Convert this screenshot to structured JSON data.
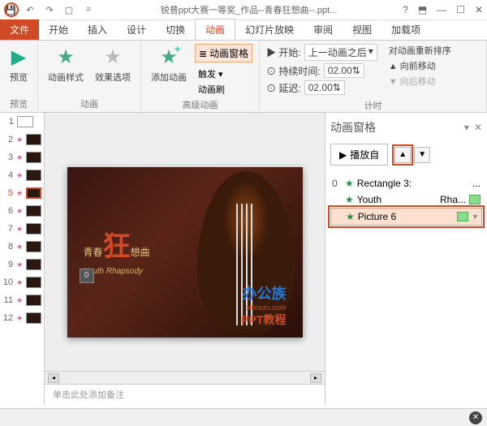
{
  "titlebar": {
    "title": "锐普ppt大赛一等奖_作品--青春狂想曲--.ppt...",
    "qat_undo": "↶",
    "qat_redo": "↷",
    "qat_slideshow": "▢",
    "qat_more": "="
  },
  "tabs": {
    "file": "文件",
    "home": "开始",
    "insert": "插入",
    "design": "设计",
    "transitions": "切换",
    "animations": "动画",
    "slideshow": "幻灯片放映",
    "review": "审阅",
    "view": "视图",
    "addins": "加载项"
  },
  "ribbon": {
    "preview": {
      "label": "预览",
      "group": "预览"
    },
    "anim": {
      "style": "动画样式",
      "options": "效果选项",
      "group": "动画"
    },
    "advanced": {
      "add": "添加动画",
      "pane": "动画窗格",
      "trigger": "触发 ▾",
      "painter": "动画刷",
      "group": "高级动画"
    },
    "timing": {
      "start_label": "▶ 开始:",
      "start_value": "上一动画之后",
      "duration_label": "⊙ 持续时间:",
      "duration_value": "02.00",
      "delay_label": "⊙ 延迟:",
      "delay_value": "02.00",
      "reorder": "对动画重新排序",
      "move_earlier": "▲ 向前移动",
      "move_later": "▼ 向后移动",
      "group": "计时"
    }
  },
  "thumbnails": [
    {
      "num": "1"
    },
    {
      "num": "2"
    },
    {
      "num": "3"
    },
    {
      "num": "4"
    },
    {
      "num": "5"
    },
    {
      "num": "6"
    },
    {
      "num": "7"
    },
    {
      "num": "8"
    },
    {
      "num": "9"
    },
    {
      "num": "10"
    },
    {
      "num": "11"
    },
    {
      "num": "12"
    }
  ],
  "slide": {
    "cn_pre": "青春",
    "cn_big": "狂",
    "cn_post": "想曲",
    "en": "Youth  Rhapsody",
    "tag": "0"
  },
  "watermark": {
    "line1": "办公族",
    "line2": "officezu.com",
    "line3": "PPT教程"
  },
  "notes": "单击此处添加备注",
  "anim_panel": {
    "title": "动画窗格",
    "play": "播放自",
    "items": [
      {
        "idx": "0",
        "name": "Rectangle 3:",
        "extra": "..."
      },
      {
        "idx": "",
        "name": "Youth",
        "extra": "Rha..."
      },
      {
        "idx": "",
        "name": "Picture 6"
      }
    ]
  },
  "status": {
    "close": "✕"
  }
}
